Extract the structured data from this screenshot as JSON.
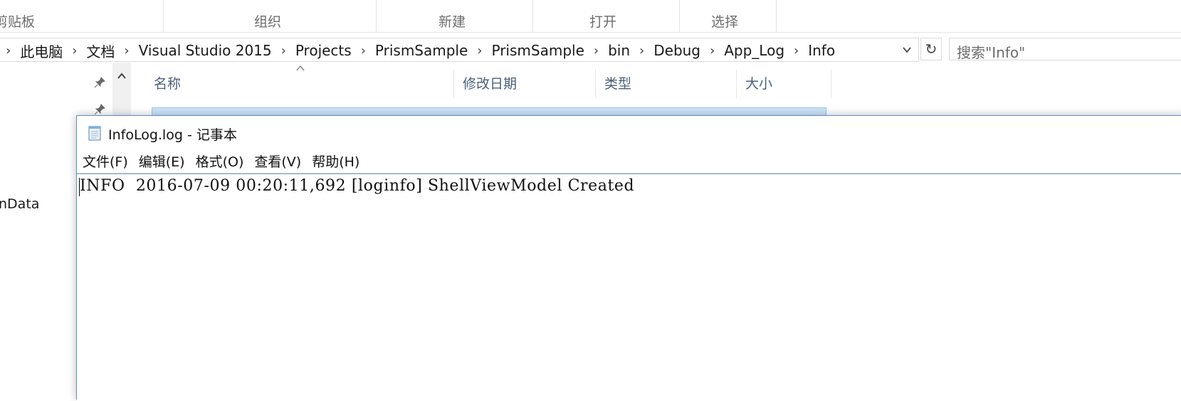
{
  "ribbon": {
    "groups": [
      "剪贴板",
      "组织",
      "新建",
      "打开",
      "选择"
    ]
  },
  "address": {
    "crumbs": [
      "此电脑",
      "文档",
      "Visual Studio 2015",
      "Projects",
      "PrismSample",
      "PrismSample",
      "bin",
      "Debug",
      "App_Log",
      "Info"
    ],
    "dropdown_icon": "chevron-down-icon",
    "refresh_icon": "refresh-icon"
  },
  "search": {
    "placeholder": "搜索\"Info\""
  },
  "nav": {
    "partial_item": "nData"
  },
  "filelist": {
    "columns": [
      "名称",
      "修改日期",
      "类型",
      "大小"
    ]
  },
  "notepad": {
    "title": "InfoLog.log - 记事本",
    "menus": [
      "文件(F)",
      "编辑(E)",
      "格式(O)",
      "查看(V)",
      "帮助(H)"
    ],
    "content_line": "INFO  2016-07-09 00:20:11,692 [loginfo] ShellViewModel Created"
  },
  "colors": {
    "accent": "#5a8fc8",
    "selection": "#cde3f7",
    "header_text": "#4c607a"
  }
}
